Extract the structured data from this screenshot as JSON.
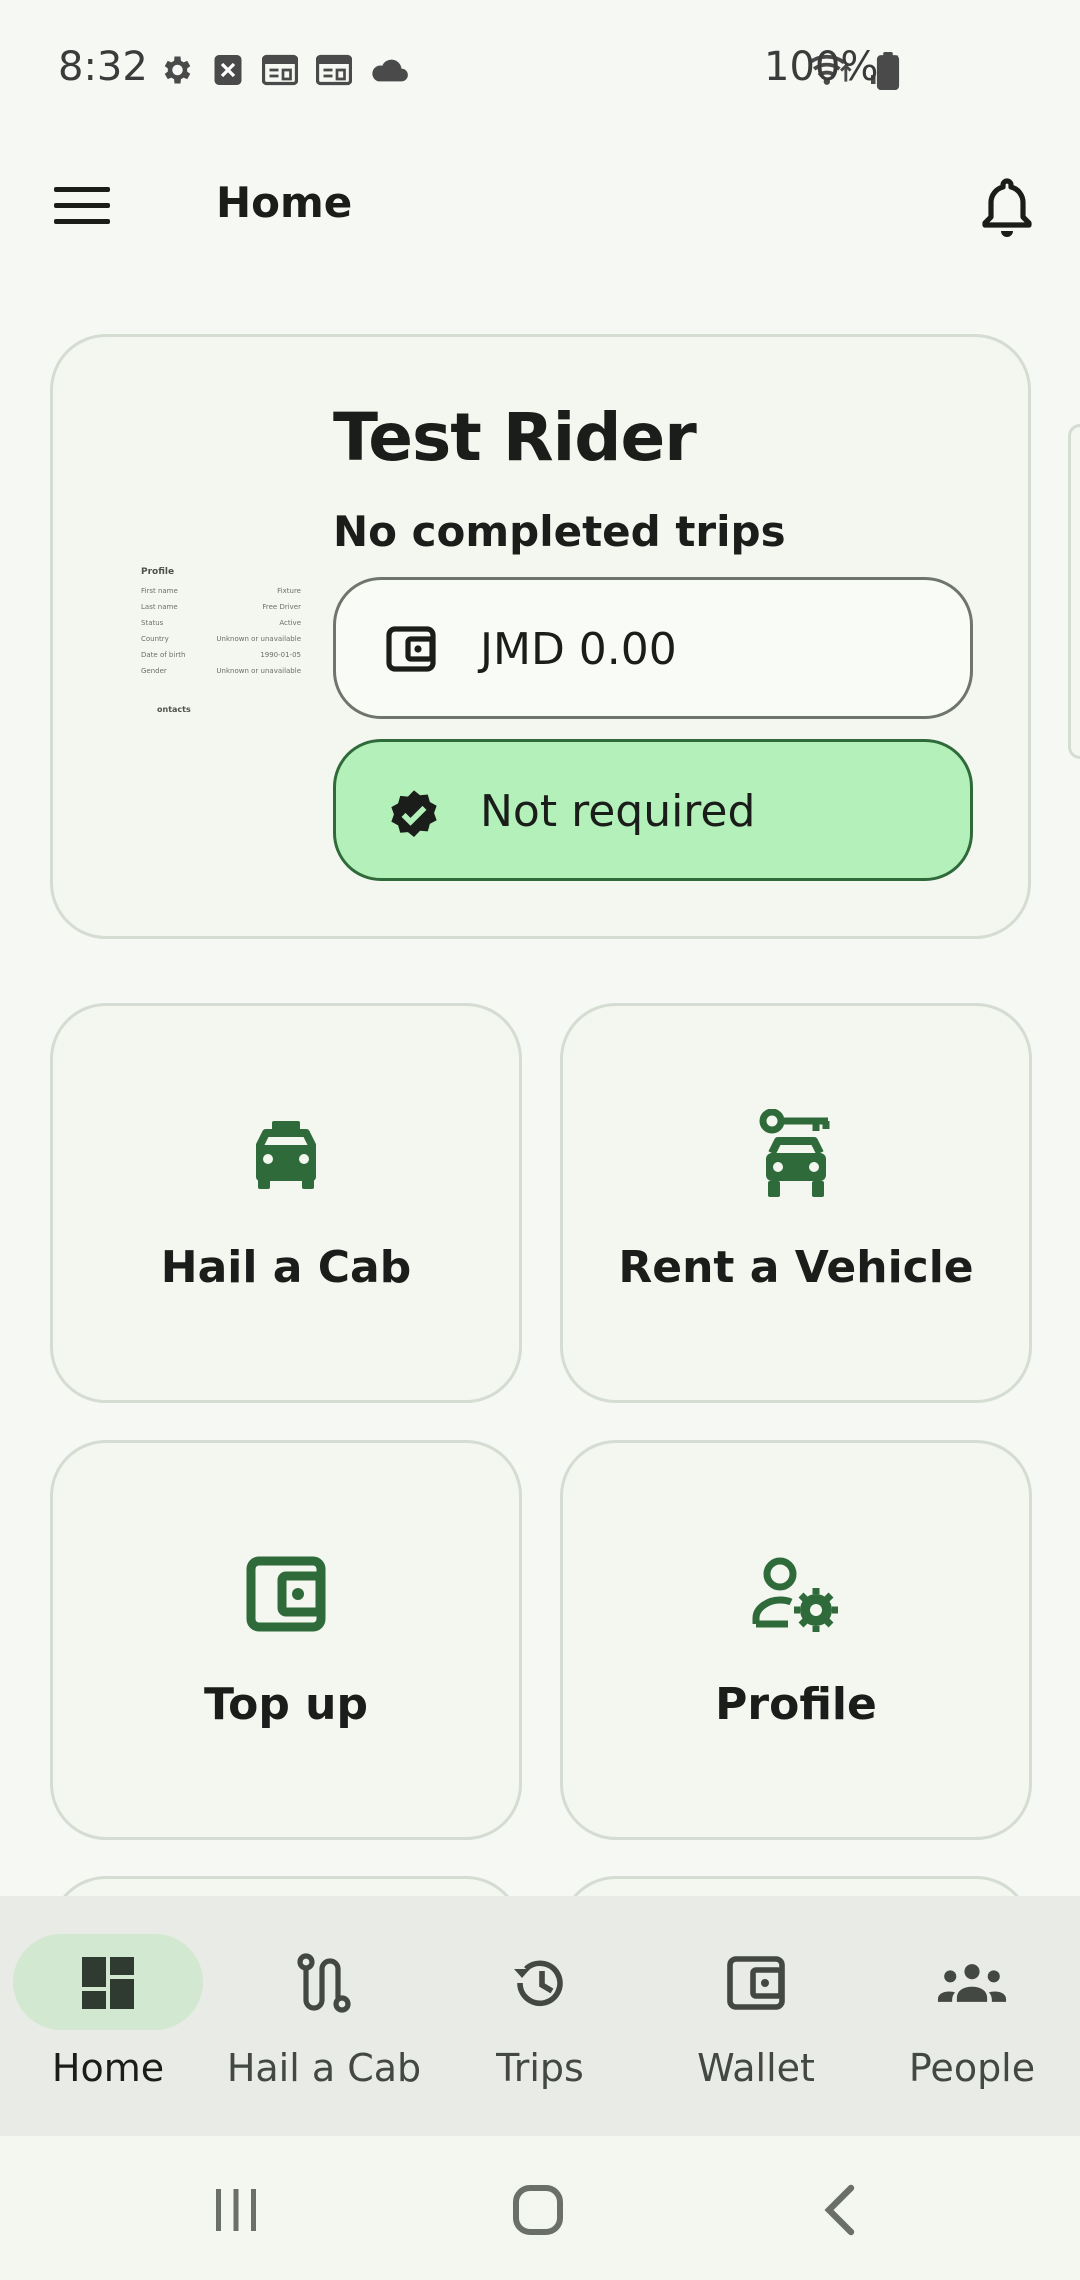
{
  "status_bar": {
    "time": "8:32",
    "battery": "100%"
  },
  "app_bar": {
    "title": "Home"
  },
  "profile": {
    "name": "Test Rider",
    "trips_summary": "No completed trips",
    "balance": "JMD 0.00",
    "verification_status": "Not required",
    "avatar_preview": {
      "title": "Profile",
      "rows": [
        {
          "label": "First name",
          "value": "Fixture"
        },
        {
          "label": "Last name",
          "value": "Free Driver"
        },
        {
          "label": "Status",
          "value": "Active"
        },
        {
          "label": "Country",
          "value": "Unknown or unavailable"
        },
        {
          "label": "Date of birth",
          "value": "1990-01-05"
        },
        {
          "label": "Gender",
          "value": "Unknown or unavailable"
        }
      ],
      "footer": "ontacts"
    }
  },
  "tiles": [
    {
      "label": "Hail a Cab",
      "icon": "taxi-icon"
    },
    {
      "label": "Rent a Vehicle",
      "icon": "car-key-icon"
    },
    {
      "label": "Top up",
      "icon": "wallet-icon"
    },
    {
      "label": "Profile",
      "icon": "person-gear-icon"
    }
  ],
  "bottom_nav": {
    "items": [
      {
        "label": "Home",
        "icon": "dashboard-icon",
        "active": true
      },
      {
        "label": "Hail a Cab",
        "icon": "route-icon",
        "active": false
      },
      {
        "label": "Trips",
        "icon": "history-icon",
        "active": false
      },
      {
        "label": "Wallet",
        "icon": "wallet-icon",
        "active": false
      },
      {
        "label": "People",
        "icon": "people-icon",
        "active": false
      }
    ]
  },
  "colors": {
    "primary": "#2f6a3a",
    "background": "#f6f8f4",
    "card": "#f3f7ef",
    "success_container": "#b4f0b9",
    "nav_indicator": "#d2e8d0"
  }
}
